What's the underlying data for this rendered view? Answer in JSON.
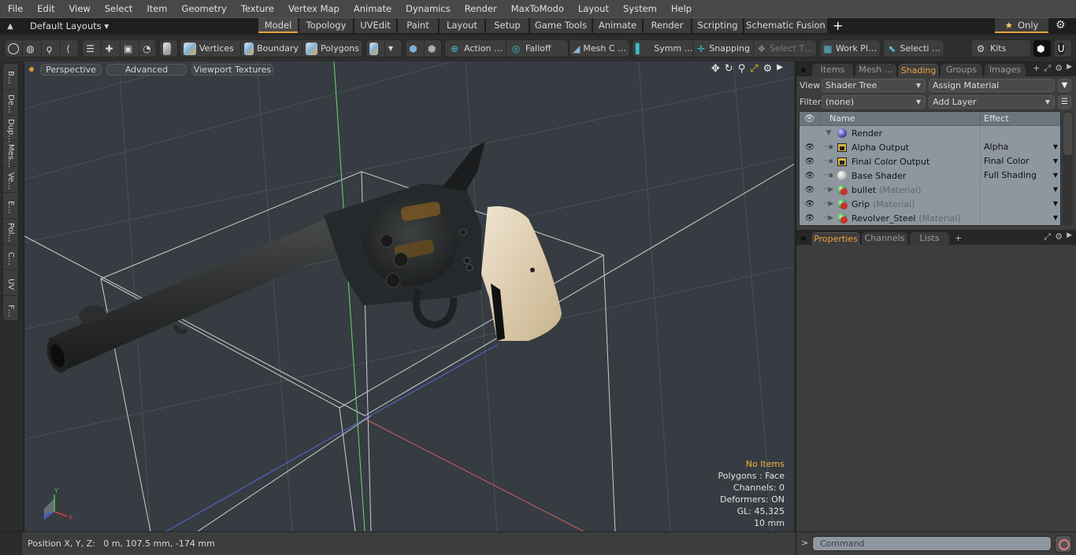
{
  "menubar": {
    "items": [
      "File",
      "Edit",
      "View",
      "Select",
      "Item",
      "Geometry",
      "Texture",
      "Vertex Map",
      "Animate",
      "Dynamics",
      "Render",
      "MaxToModo",
      "Layout",
      "System",
      "Help"
    ]
  },
  "layoutbar": {
    "default_layouts": "Default Layouts ▾",
    "tabs": [
      {
        "label": "Model",
        "active": true
      },
      {
        "label": "Topology"
      },
      {
        "label": "UVEdit"
      },
      {
        "label": "Paint"
      },
      {
        "label": "Layout"
      },
      {
        "label": "Setup"
      },
      {
        "label": "Game Tools"
      },
      {
        "label": "Animate"
      },
      {
        "label": "Render"
      },
      {
        "label": "Scripting"
      },
      {
        "label": "Schematic Fusion"
      }
    ],
    "add_tab": "+",
    "only_label": "Only"
  },
  "toolbar": {
    "vertices": "Vertices",
    "boundary": "Boundary",
    "polygons": "Polygons",
    "action": "Action   …",
    "falloff": "Falloff",
    "mesh_c": "Mesh C …",
    "symm": "Symm …",
    "snapping": "Snapping",
    "select_t": "Select T…",
    "work_pl": "Work Pl…",
    "selecti": "Selecti …",
    "kits": "Kits"
  },
  "left_strip": {
    "items": [
      "B…",
      "De…",
      "Dup…",
      "Mes…",
      "Ve…",
      "E…",
      "Pol…",
      "C…",
      "UV",
      "F…"
    ]
  },
  "viewport": {
    "buttons": [
      "Perspective",
      "Advanced",
      "Viewport Textures"
    ],
    "info": {
      "selection": "No Items",
      "mode": "Polygons : Face",
      "channels": "Channels: 0",
      "deformers": "Deformers: ON",
      "gl": "GL: 45,325",
      "grid": "10 mm"
    },
    "axis_labels": {
      "x": "X",
      "y": "Y",
      "z": "Z"
    }
  },
  "statusbar": {
    "position": "Position X, Y, Z:   0 m, 107.5 mm, -174 mm"
  },
  "right_panel": {
    "top_tabs": [
      {
        "label": "Items"
      },
      {
        "label": "Mesh …"
      },
      {
        "label": "Shading",
        "active": true
      },
      {
        "label": "Groups"
      },
      {
        "label": "Images"
      }
    ],
    "view_label": "View",
    "view_value": "Shader Tree",
    "assign_material": "Assign Material",
    "filter_label": "Filter",
    "filter_value": "(none)",
    "add_layer": "Add Layer",
    "tree_headers": {
      "name": "Name",
      "effect": "Effect"
    },
    "tree_rows": [
      {
        "name": "Render",
        "sub": "",
        "effect": "",
        "icon": "render-sphere",
        "eye": false,
        "level": 0
      },
      {
        "name": "Alpha Output",
        "sub": "",
        "effect": "Alpha",
        "icon": "output",
        "eye": true,
        "level": 1
      },
      {
        "name": "Final Color Output",
        "sub": "",
        "effect": "Final Color",
        "icon": "output",
        "eye": true,
        "level": 1
      },
      {
        "name": "Base Shader",
        "sub": "",
        "effect": "Full Shading",
        "icon": "shader",
        "eye": true,
        "level": 1
      },
      {
        "name": "bullet",
        "sub": "(Material)",
        "effect": "",
        "icon": "material",
        "eye": true,
        "level": 1
      },
      {
        "name": "Grip",
        "sub": "(Material)",
        "effect": "",
        "icon": "material",
        "eye": true,
        "level": 1
      },
      {
        "name": "Revolver_Steel",
        "sub": "(Material)",
        "effect": "",
        "icon": "material",
        "eye": true,
        "level": 1
      }
    ],
    "bottom_tabs": [
      {
        "label": "Properties",
        "active": true
      },
      {
        "label": "Channels"
      },
      {
        "label": "Lists"
      }
    ]
  },
  "command": {
    "placeholder": "Command",
    "prompt": ">"
  },
  "colors": {
    "accent": "#e8a33c",
    "viewport_bg": "#363c42",
    "info_highlight": "#f2b640"
  }
}
